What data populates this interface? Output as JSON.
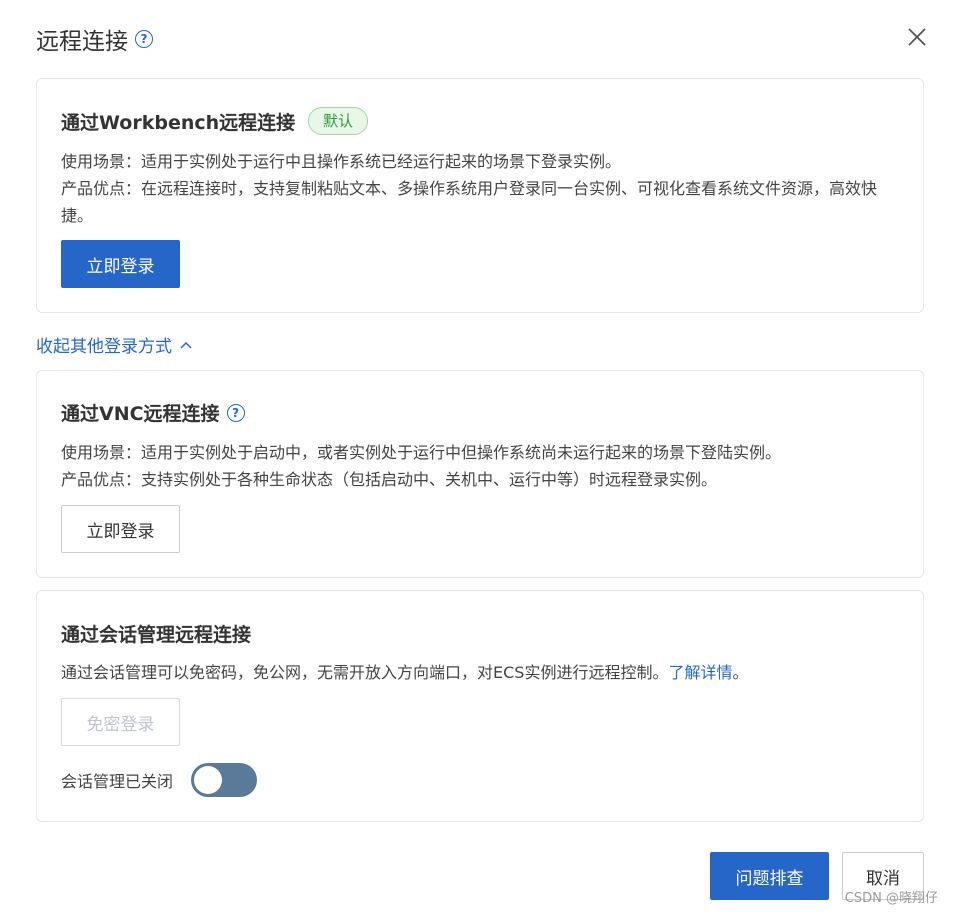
{
  "dialog": {
    "title": "远程连接",
    "help_icon": "?",
    "close_icon": "close-icon"
  },
  "workbench": {
    "title": "通过Workbench远程连接",
    "badge": "默认",
    "scenario": "使用场景：适用于实例处于运行中且操作系统已经运行起来的场景下登录实例。",
    "advantage": "产品优点：在远程连接时，支持复制粘贴文本、多操作系统用户登录同一台实例、可视化查看系统文件资源，高效快捷。",
    "login_button": "立即登录"
  },
  "collapse_link": "收起其他登录方式",
  "vnc": {
    "title": "通过VNC远程连接",
    "help_icon": "?",
    "scenario": "使用场景：适用于实例处于启动中，或者实例处于运行中但操作系统尚未运行起来的场景下登陆实例。",
    "advantage": "产品优点：支持实例处于各种生命状态（包括启动中、关机中、运行中等）时远程登录实例。",
    "login_button": "立即登录"
  },
  "session": {
    "title": "通过会话管理远程连接",
    "description": "通过会话管理可以免密码，免公网，无需开放入方向端口，对ECS实例进行远程控制。",
    "learn_more": "了解详情",
    "period": "。",
    "passwordless_button": "免密登录",
    "toggle_label": "会话管理已关闭",
    "toggle_state": "off"
  },
  "footer": {
    "troubleshoot_button": "问题排查",
    "cancel_button": "取消"
  },
  "watermark": "CSDN @晓翔仔",
  "colors": {
    "primary": "#2566c8",
    "link": "#2468cc",
    "badge_green": "#2f9e3a",
    "toggle_off": "#5a7a99"
  }
}
